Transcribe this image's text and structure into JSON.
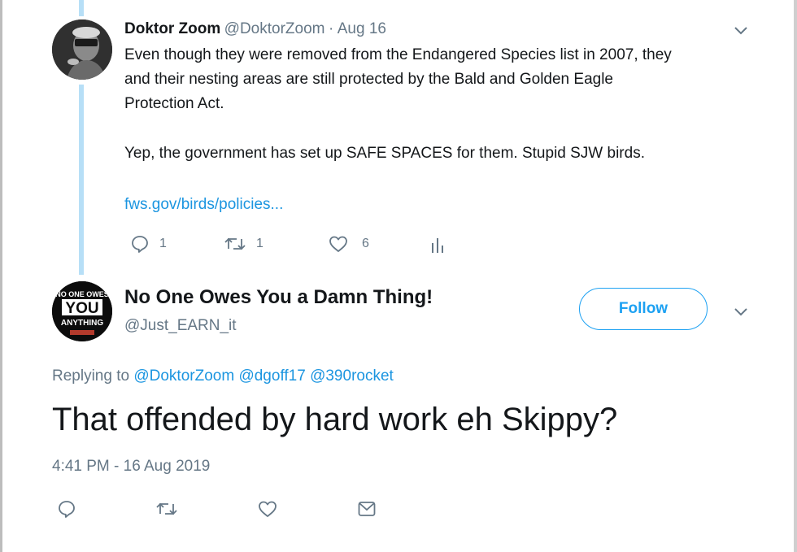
{
  "parent_tweet": {
    "display_name": "Doktor Zoom",
    "handle": "@DoktorZoom",
    "separator": "·",
    "date": "Aug 16",
    "lines": [
      "Even though they were removed from the Endangered Species list in 2007, they",
      "and their nesting areas are still protected by the Bald and Golden Eagle",
      "Protection Act."
    ],
    "line2": "Yep, the government has set up SAFE SPACES for them. Stupid SJW birds.",
    "link": "fws.gov/birds/policies...",
    "reply_count": "1",
    "retweet_count": "1",
    "like_count": "6",
    "colors": {
      "thread_line": "#b7dff7",
      "link": "#1b95e0",
      "muted": "#657786"
    }
  },
  "main_tweet": {
    "display_name": "No One Owes You a Damn Thing!",
    "handle": "@Just_EARN_it",
    "follow_label": "Follow",
    "avatar_text": {
      "top": "NO ONE OWES",
      "middle": "YOU",
      "bottom": "ANYTHING"
    },
    "replying_prefix": "Replying to",
    "replying_to": [
      "@DoktorZoom",
      "@dgoff17",
      "@390rocket"
    ],
    "text": "That offended by hard work eh Skippy?",
    "timestamp": "4:41 PM - 16 Aug 2019",
    "icons": [
      "reply-icon",
      "retweet-icon",
      "like-icon",
      "message-icon"
    ],
    "colors": {
      "accent": "#1da1f2"
    }
  }
}
